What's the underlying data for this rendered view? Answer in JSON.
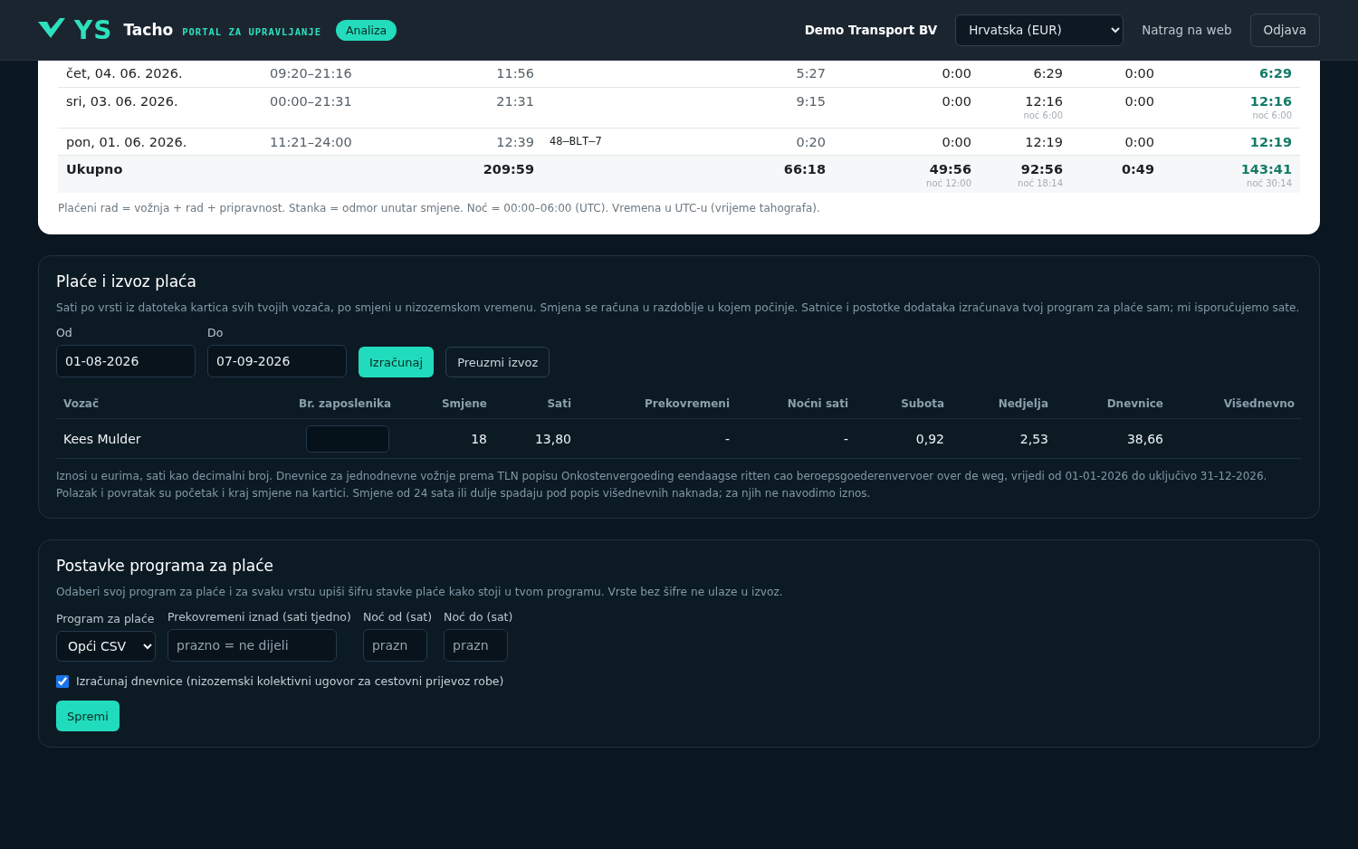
{
  "header": {
    "logo_text": "YS",
    "brand": "Tacho",
    "tagline": "PORTAL ZA UPRAVLJANJE",
    "badge": "Analiza",
    "company": "Demo Transport BV",
    "region_select": "Hrvatska (EUR)",
    "back_link": "Natrag na web",
    "logout": "Odjava"
  },
  "shift_table": {
    "rows": [
      {
        "kind": "day",
        "column_1": "čet, 04. 06. 2026.",
        "column_2": "09:20–21:16",
        "column_3": "11:56",
        "column_4": "",
        "column_5": "5:27",
        "column_6": "0:00",
        "column_7": "6:29",
        "column_8": "0:00",
        "column_9": "6:29"
      },
      {
        "kind": "day",
        "column_1": "sri, 03. 06. 2026.",
        "column_2": "00:00–21:31",
        "column_3": "21:31",
        "column_4": "",
        "column_5": "9:15",
        "column_6": "0:00",
        "column_7": "12:16",
        "column_7_note": "noć 6:00",
        "column_8": "0:00",
        "column_9": "12:16",
        "column_9_note": "noć 6:00"
      },
      {
        "kind": "day",
        "column_1": "pon, 01. 06. 2026.",
        "column_2": "11:21–24:00",
        "column_3": "12:39",
        "column_4": "48–BLT–7",
        "column_5": "0:20",
        "column_6": "0:00",
        "column_7": "12:19",
        "column_8": "0:00",
        "column_9": "12:19"
      },
      {
        "kind": "total",
        "column_1": "Ukupno",
        "column_2": "",
        "column_3": "209:59",
        "column_4": "",
        "column_5": "66:18",
        "column_6": "49:56",
        "column_6_note": "noć 12:00",
        "column_7": "92:56",
        "column_7_note": "noć 18:14",
        "column_8": "0:49",
        "column_9": "143:41",
        "column_9_note": "noć 30:14"
      }
    ],
    "footnote": "Plaćeni rad = vožnja + rad + pripravnost. Stanka = odmor unutar smjene. Noć = 00:00–06:00 (UTC). Vremena u UTC-u (vrijeme tahografa)."
  },
  "payroll": {
    "title": "Plaće i izvoz plaća",
    "description": "Sati po vrsti iz datoteka kartica svih tvojih vozača, po smjeni u nizozemskom vremenu. Smjena se računa u razdoblje u kojem počinje. Satnice i postotke dodataka izračunava tvoj program za plaće sam; mi isporučujemo sate.",
    "from_label": "Od",
    "from_value": "01-08-2026",
    "to_label": "Do",
    "to_value": "07-09-2026",
    "calculate": "Izračunaj",
    "download": "Preuzmi izvoz",
    "columns": [
      "Vozač",
      "Br. zaposlenika",
      "Smjene",
      "Sati",
      "Prekovremeni",
      "Noćni sati",
      "Subota",
      "Nedjelja",
      "Dnevnice",
      "Višednevno"
    ],
    "rows": [
      {
        "driver": "Kees Mulder",
        "shifts": "18",
        "hours": "13,80",
        "overtime": "-",
        "night": "-",
        "saturday": "0,92",
        "sunday": "2,53",
        "allowance": "38,66"
      }
    ],
    "note": "Iznosi u eurima, sati kao decimalni broj. Dnevnice za jednodnevne vožnje prema TLN popisu Onkostenvergoeding eendaagse ritten cao beroepsgoederenvervoer over de weg, vrijedi od 01-01-2026 do uključivo 31-12-2026. Polazak i povratak su početak i kraj smjene na kartici. Smjene od 24 sata ili dulje spadaju pod popis višednevnih naknada; za njih ne navodimo iznos."
  },
  "settings": {
    "title": "Postavke programa za plaće",
    "description": "Odaberi svoj program za plaće i za svaku vrstu upiši šifru stavke plaće kako stoji u tvom programu. Vrste bez šifre ne ulaze u izvoz.",
    "program_label": "Program za plaće",
    "program_value": "Opći CSV",
    "overtime_label": "Prekovremeni iznad (sati tjedno)",
    "overtime_placeholder": "prazno = ne dijeli",
    "night_from_label": "Noć od (sat)",
    "night_from_placeholder": "prazn",
    "night_to_label": "Noć do (sat)",
    "night_to_placeholder": "prazn",
    "allowance_checkbox": {
      "label": "Izračunaj dnevnice (nizozemski kolektivni ugovor za cestovni prijevoz robe)",
      "checked": true
    },
    "save": "Spremi"
  }
}
